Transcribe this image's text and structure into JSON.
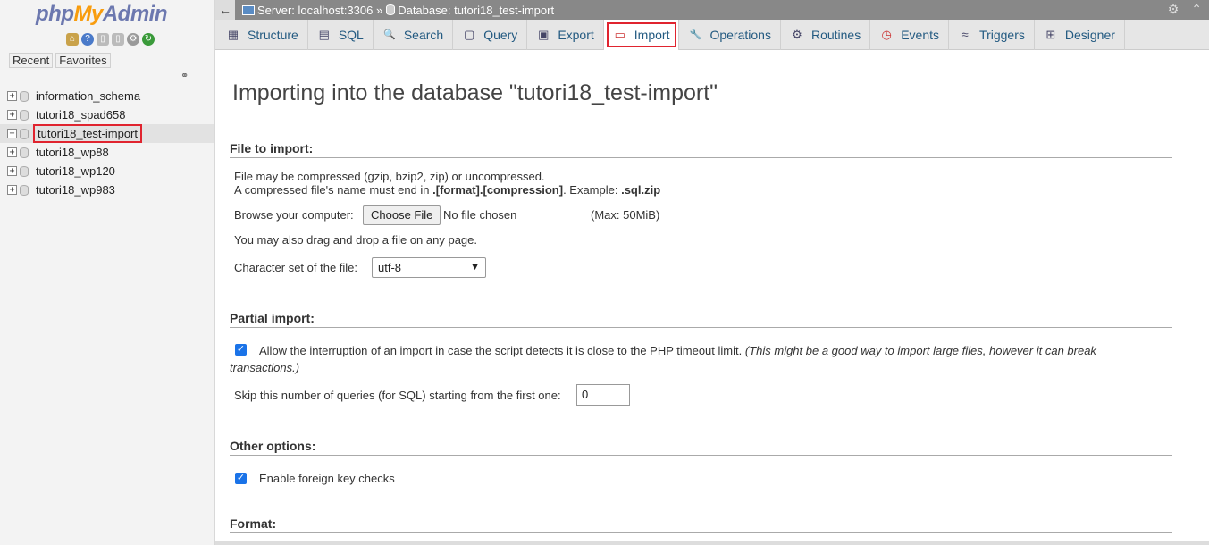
{
  "sidebar": {
    "logo": {
      "php": "php",
      "my": "My",
      "admin": "Admin"
    },
    "recent_label": "Recent",
    "favorites_label": "Favorites",
    "databases": [
      {
        "name": "information_schema",
        "expander": "+"
      },
      {
        "name": "tutori18_spad658",
        "expander": "+"
      },
      {
        "name": "tutori18_test-import",
        "expander": "−"
      },
      {
        "name": "tutori18_wp88",
        "expander": "+"
      },
      {
        "name": "tutori18_wp120",
        "expander": "+"
      },
      {
        "name": "tutori18_wp983",
        "expander": "+"
      }
    ]
  },
  "topbar": {
    "back": "←",
    "server_crumb": "Server: localhost:3306 »",
    "db_crumb": "Database: tutori18_test-import"
  },
  "tabs": [
    {
      "label": "Structure",
      "icon": "▦"
    },
    {
      "label": "SQL",
      "icon": "▤"
    },
    {
      "label": "Search",
      "icon": "🔍"
    },
    {
      "label": "Query",
      "icon": "▢"
    },
    {
      "label": "Export",
      "icon": "▣"
    },
    {
      "label": "Import",
      "icon": "▭"
    },
    {
      "label": "Operations",
      "icon": "🔧"
    },
    {
      "label": "Routines",
      "icon": "⚙"
    },
    {
      "label": "Events",
      "icon": "◷"
    },
    {
      "label": "Triggers",
      "icon": "≈"
    },
    {
      "label": "Designer",
      "icon": "⊞"
    }
  ],
  "main": {
    "title": "Importing into the database \"tutori18_test-import\"",
    "file_to_import": {
      "heading": "File to import:",
      "compress_line1": "File may be compressed (gzip, bzip2, zip) or uncompressed.",
      "compress_line2_prefix": "A compressed file's name must end in ",
      "compress_line2_bold": ".[format].[compression]",
      "compress_line2_mid": ". Example: ",
      "compress_line2_example": ".sql.zip",
      "browse_label": "Browse your computer:",
      "choose_file": "Choose File",
      "no_file": "No file chosen",
      "max_size": "(Max: 50MiB)",
      "drag_drop": "You may also drag and drop a file on any page.",
      "charset_label": "Character set of the file:",
      "charset_value": "utf-8"
    },
    "partial_import": {
      "heading": "Partial import:",
      "allow_interrupt": "Allow the interruption of an import in case the script detects it is close to the PHP timeout limit.",
      "allow_interrupt_note_1": "(This might be a good way to import large files, however it can break",
      "allow_interrupt_note_2": "transactions.)",
      "skip_label": "Skip this number of queries (for SQL) starting from the first one:",
      "skip_value": "0"
    },
    "other_options": {
      "heading": "Other options:",
      "foreign_key": "Enable foreign key checks"
    },
    "format": {
      "heading": "Format:"
    }
  }
}
